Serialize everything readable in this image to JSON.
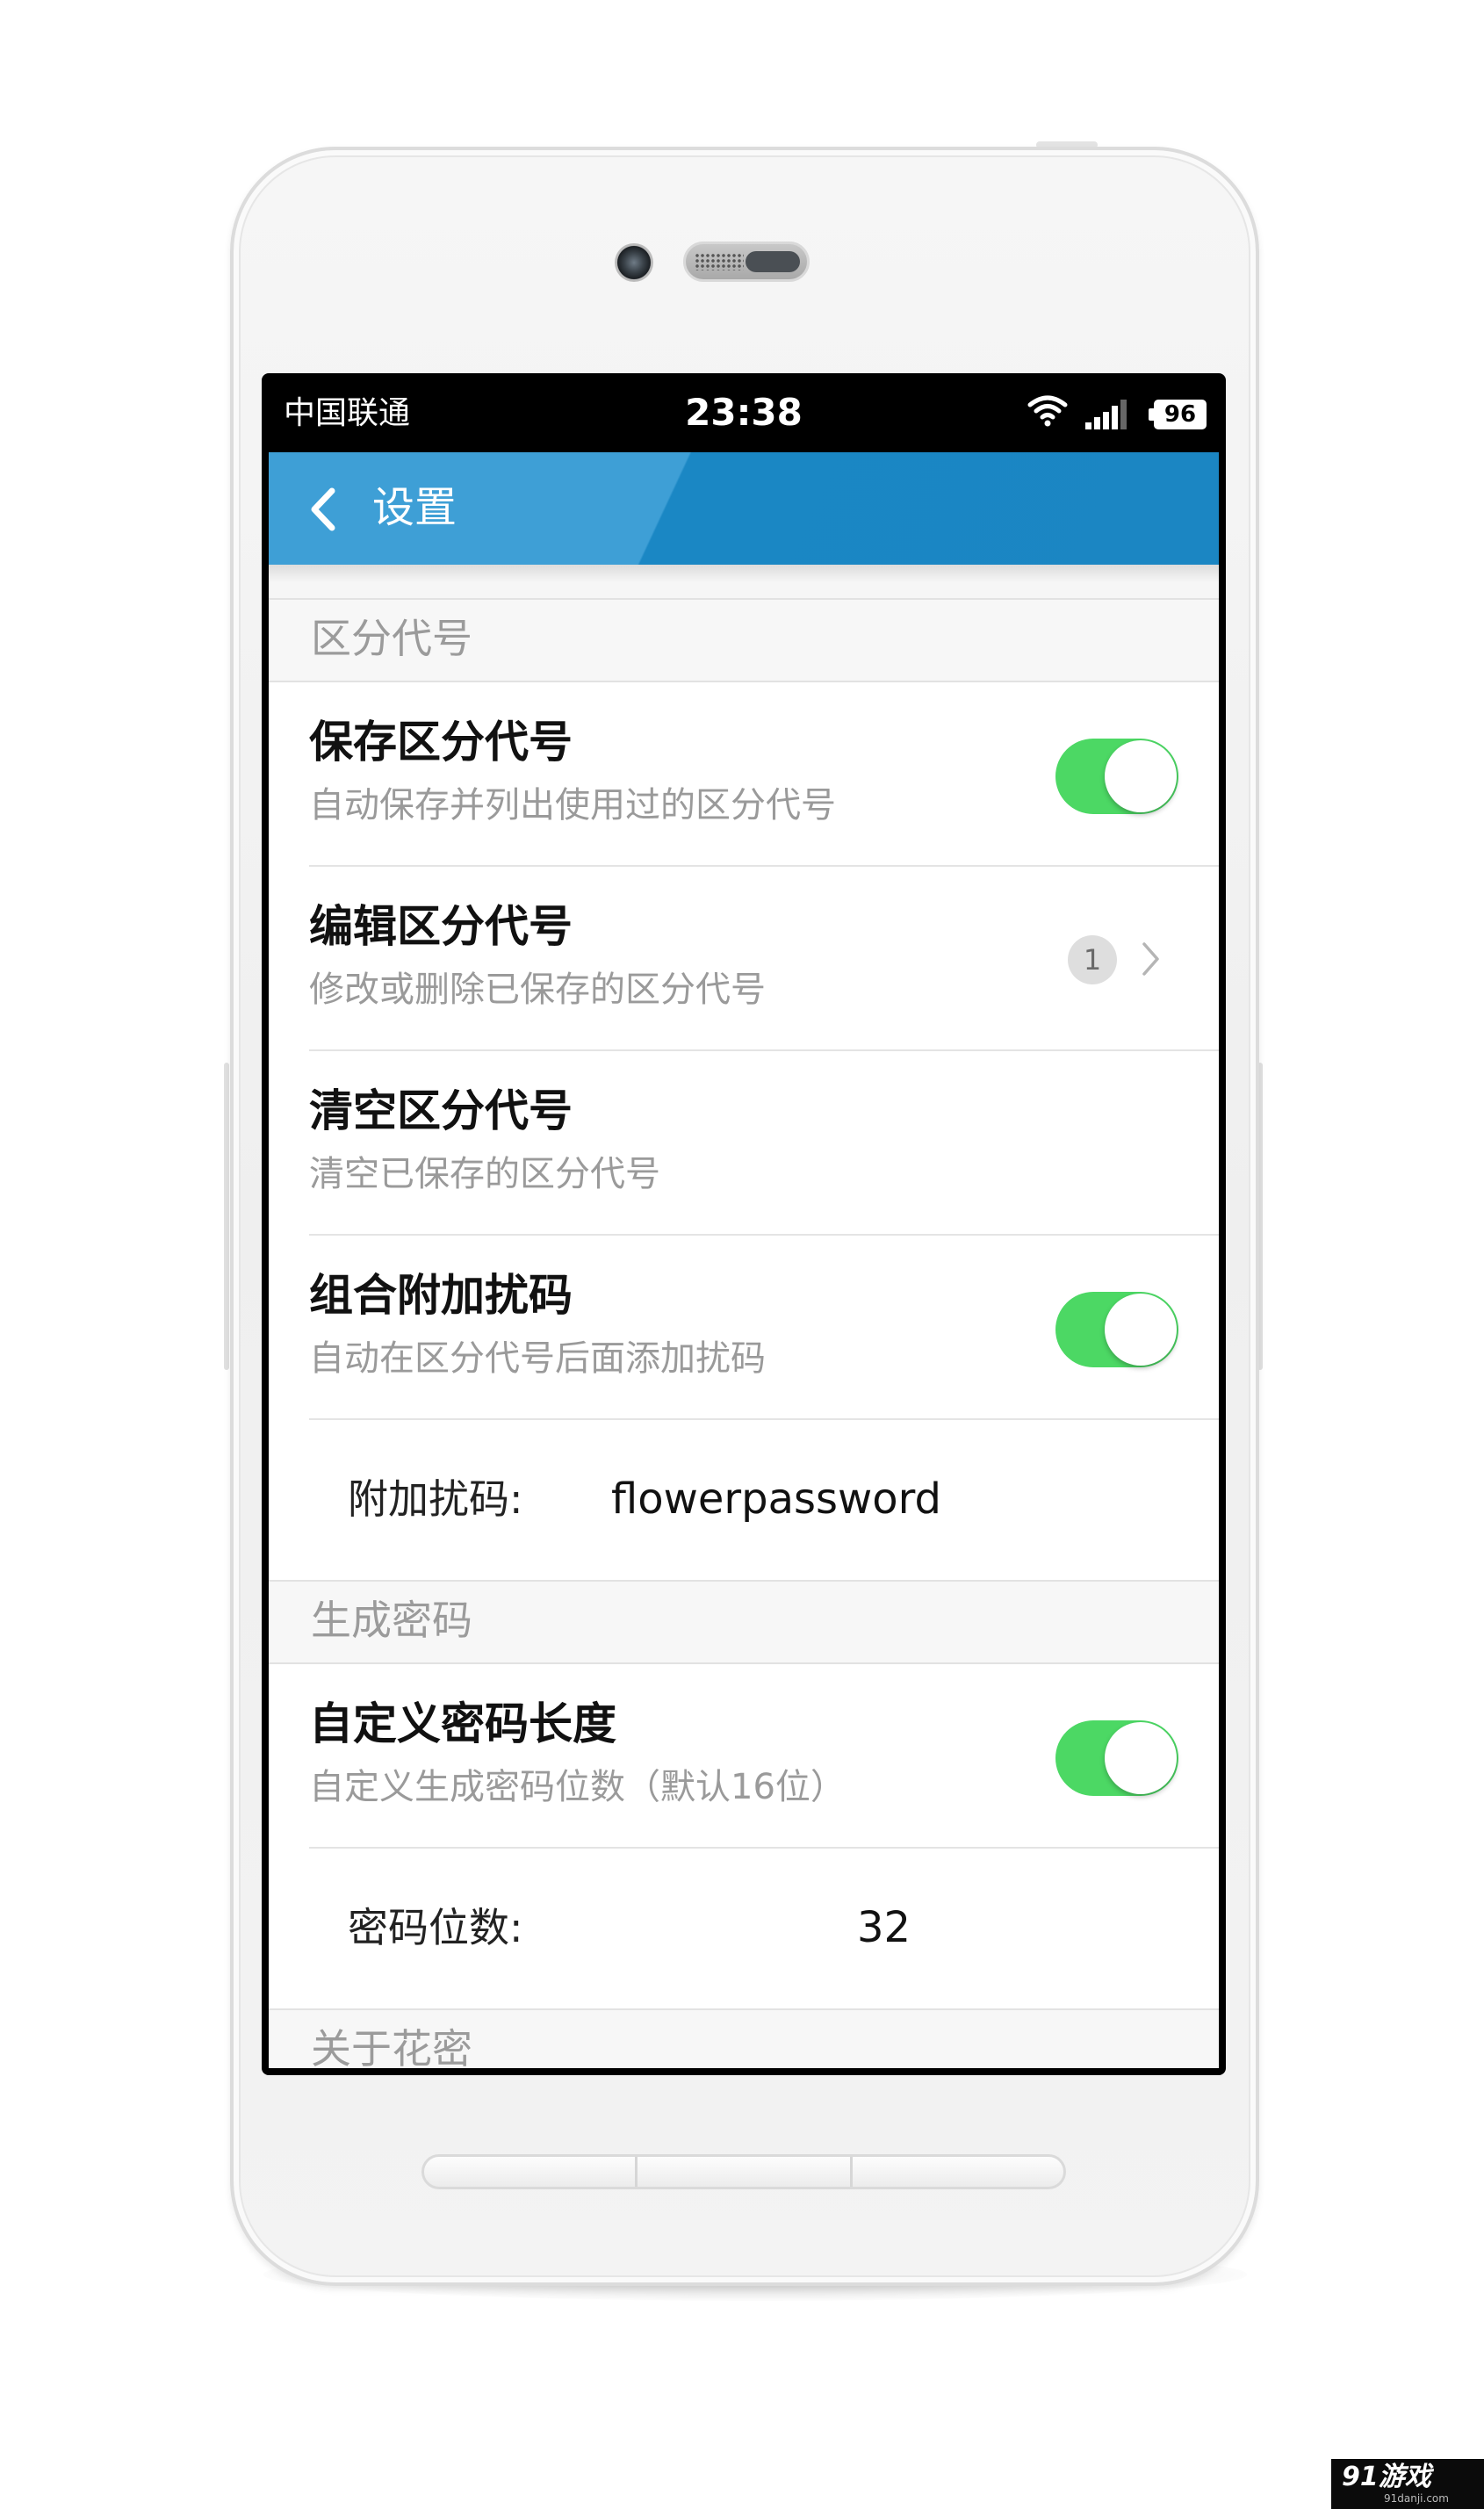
{
  "status_bar": {
    "carrier": "中国联通",
    "time": "23:38",
    "battery": "96",
    "icons": [
      "wifi-icon",
      "signal-icon",
      "battery-icon"
    ]
  },
  "app_bar": {
    "back_icon": "chevron-left-icon",
    "title": "设置",
    "color": "#1b86c3"
  },
  "sections": {
    "distinguish_code": {
      "header": "区分代号",
      "save": {
        "title": "保存区分代号",
        "subtitle": "自动保存并列出使用过的区分代号",
        "enabled": true
      },
      "edit": {
        "title": "编辑区分代号",
        "subtitle": "修改或删除已保存的区分代号",
        "count": "1"
      },
      "clear": {
        "title": "清空区分代号",
        "subtitle": "清空已保存的区分代号"
      },
      "combine": {
        "title": "组合附加扰码",
        "subtitle": "自动在区分代号后面添加扰码",
        "enabled": true
      },
      "extra_code": {
        "label": "附加扰码:",
        "value": "flowerpassword"
      }
    },
    "generate_password": {
      "header": "生成密码",
      "custom_length": {
        "title": "自定义密码长度",
        "subtitle": "自定义生成密码位数（默认16位）",
        "enabled": true
      },
      "length": {
        "label": "密码位数:",
        "value": "32"
      }
    },
    "about": {
      "header": "关于花密"
    }
  },
  "toggle_color": "#4cd864",
  "watermark": {
    "text": "91游戏",
    "url": "91danji.com"
  }
}
